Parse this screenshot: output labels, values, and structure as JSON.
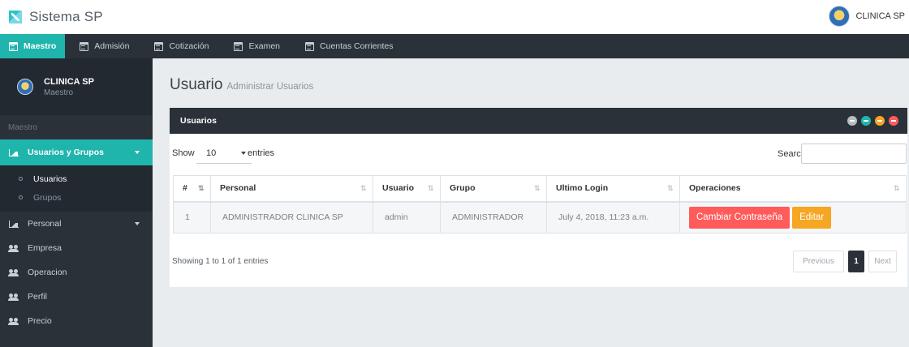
{
  "header": {
    "app_title": "Sistema SP",
    "user_name": "CLINICA SP"
  },
  "nav": {
    "items": [
      {
        "label": "Maestro",
        "active": true
      },
      {
        "label": "Admisión",
        "active": false
      },
      {
        "label": "Cotización",
        "active": false
      },
      {
        "label": "Examen",
        "active": false
      },
      {
        "label": "Cuentas Corrientes",
        "active": false
      }
    ]
  },
  "sidebar": {
    "profile_name": "CLINICA SP",
    "profile_role": "Maestro",
    "section_label": "Maestro",
    "group_label": "Usuarios y Grupos",
    "sub_items": [
      {
        "label": "Usuarios",
        "active": true
      },
      {
        "label": "Grupos",
        "active": false
      }
    ],
    "items": [
      {
        "label": "Personal",
        "icon": "chart-icon",
        "has_caret": true
      },
      {
        "label": "Empresa",
        "icon": "users-icon"
      },
      {
        "label": "Operacion",
        "icon": "users-icon"
      },
      {
        "label": "Perfil",
        "icon": "users-icon"
      },
      {
        "label": "Precio",
        "icon": "users-icon"
      }
    ]
  },
  "page": {
    "title": "Usuario",
    "subtitle": "Administrar Usuarios"
  },
  "panel": {
    "title": "Usuarios",
    "tools": [
      {
        "name": "refresh-tool-icon",
        "color": "#b6bcc2"
      },
      {
        "name": "reload-tool-icon",
        "color": "#1fb5ad"
      },
      {
        "name": "collapse-tool-icon",
        "color": "#f5a623"
      },
      {
        "name": "close-tool-icon",
        "color": "#ff5b5b"
      }
    ]
  },
  "table_controls": {
    "show_label": "Show",
    "length_value": "10",
    "entries_label": "entries",
    "search_label": "Search:",
    "search_value": ""
  },
  "table": {
    "columns": [
      "#",
      "Personal",
      "Usuario",
      "Grupo",
      "Ultimo Login",
      "Operaciones"
    ],
    "rows": [
      {
        "num": "1",
        "personal": "ADMINISTRADOR CLINICA SP",
        "usuario": "admin",
        "grupo": "ADMINISTRADOR",
        "ultimo_login": "July 4, 2018, 11:23 a.m.",
        "btn_password": "Cambiar Contraseña",
        "btn_edit": "Editar"
      }
    ]
  },
  "footer": {
    "info": "Showing 1 to 1 of 1 entries",
    "prev": "Previous",
    "current": "1",
    "next": "Next"
  },
  "colors": {
    "accent": "#1fb5ad",
    "dark": "#2b3138",
    "danger": "#ff5b5b",
    "warning": "#f5a623"
  }
}
